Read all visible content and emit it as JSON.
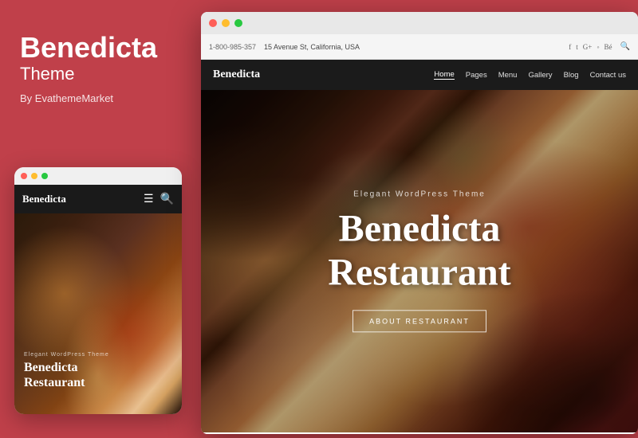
{
  "leftPanel": {
    "title": "Benedicta",
    "subtitle": "Theme",
    "author": "By EvathemeMarket"
  },
  "mobileMockup": {
    "dots": [
      {
        "color": "#ff5f57"
      },
      {
        "color": "#ffbd2e"
      },
      {
        "color": "#28c840"
      }
    ],
    "nav": {
      "title": "Benedicta",
      "hamburger": "☰",
      "search": "🔍"
    },
    "hero": {
      "elegantLabel": "Elegant WordPress Theme",
      "title": "Benedicta",
      "subtitle": "Restaurant"
    }
  },
  "desktopMockup": {
    "titleBar": {
      "dots": [
        {
          "color": "#ff5f57"
        },
        {
          "color": "#ffbd2e"
        },
        {
          "color": "#28c840"
        }
      ]
    },
    "browserBar": {
      "phone": "1-800-985-357",
      "address": "15 Avenue St, California, USA"
    },
    "websiteNav": {
      "title": "Benedicta",
      "links": [
        "Home",
        "Pages",
        "Menu",
        "Gallery",
        "Blog",
        "Contact us"
      ],
      "activeLink": "Home"
    },
    "hero": {
      "elegantLabel": "Elegant WordPress Theme",
      "titleLine1": "Benedicta",
      "titleLine2": "Restaurant",
      "ctaButton": "ABOUT RESTAURANT"
    }
  }
}
